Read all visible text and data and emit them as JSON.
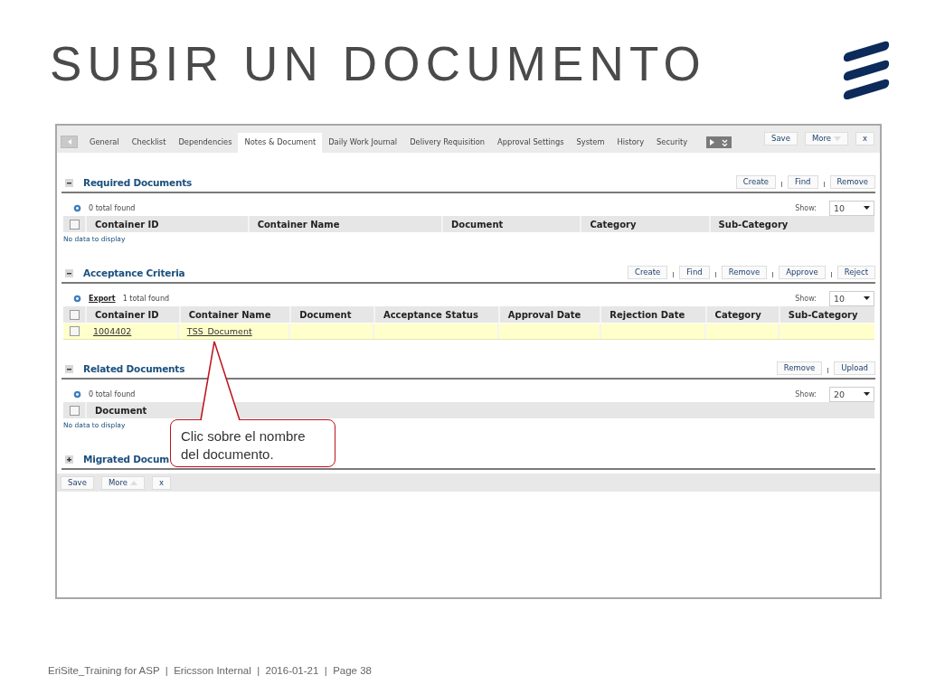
{
  "slide": {
    "title": "SUBIR UN DOCUMENTO",
    "footer": "EriSite_Training for ASP  |  Ericsson Internal  |  2016-01-21  |  Page 38"
  },
  "app": {
    "tabs": [
      {
        "label": "General",
        "selected": false
      },
      {
        "label": "Checklist",
        "selected": false
      },
      {
        "label": "Dependencies",
        "selected": false
      },
      {
        "label": "Notes & Document",
        "selected": true
      },
      {
        "label": "Daily Work Journal",
        "selected": false
      },
      {
        "label": "Delivery Requisition",
        "selected": false
      },
      {
        "label": "Approval Settings",
        "selected": false
      },
      {
        "label": "System",
        "selected": false
      },
      {
        "label": "History",
        "selected": false
      },
      {
        "label": "Security",
        "selected": false
      }
    ],
    "header_buttons": [
      "Save",
      "More",
      "x"
    ],
    "sections": [
      {
        "title": "Required Documents",
        "expanded": true,
        "actions": [
          "Create",
          "Find",
          "Remove"
        ],
        "count": "0 total found",
        "show_label": "Show:",
        "show": "10",
        "all_checked": false,
        "columns": [
          "Container ID",
          "Container Name",
          "Document",
          "Category",
          "Sub-Category"
        ],
        "empty_text": "No data to display"
      },
      {
        "title": "Acceptance Criteria",
        "expanded": true,
        "actions": [
          "Create",
          "Find",
          "Remove",
          "Approve",
          "Reject"
        ],
        "export": "Export",
        "count": "1 total found",
        "show_label": "Show:",
        "show": "10",
        "all_checked": false,
        "columns": [
          "Container ID",
          "Container Name",
          "Document",
          "Acceptance Status",
          "Approval Date",
          "Rejection Date",
          "Category",
          "Sub-Category"
        ],
        "rows": [
          {
            "checked": false,
            "highlighted": true,
            "cells": [
              "1004402",
              "TSS_Document"
            ]
          }
        ]
      },
      {
        "title": "Related Documents",
        "expanded": true,
        "actions": [
          "Remove",
          "Upload"
        ],
        "count": "0 total found",
        "show_label": "Show:",
        "show": "20",
        "all_checked": false,
        "columns": [
          "Document"
        ],
        "empty_text": "No data to display"
      },
      {
        "title": "Migrated Docum",
        "expanded": false
      }
    ],
    "footer_buttons": [
      "Save",
      "More",
      "x"
    ]
  },
  "callout": {
    "text": "Clic sobre el nombre del documento."
  }
}
